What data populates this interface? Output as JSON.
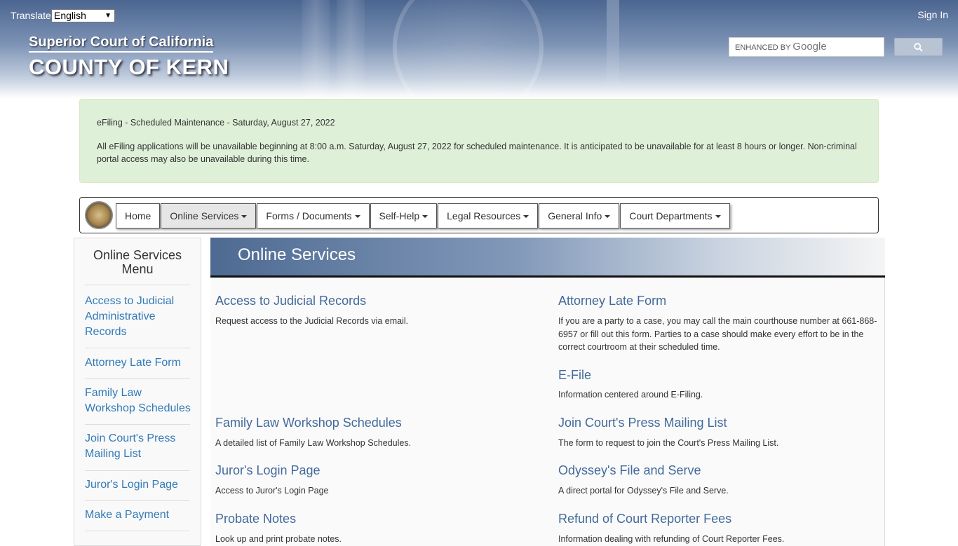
{
  "header": {
    "translate_label": "Translate",
    "language": "English",
    "sign_in": "Sign In",
    "court_name": "Superior Court of California",
    "county_name": "COUNTY OF KERN",
    "search_enhanced": "ENHANCED BY",
    "search_brand": "Google"
  },
  "alert": {
    "title": "eFiling - Scheduled Maintenance - Saturday, August 27, 2022",
    "body": "All eFiling applications will be unavailable beginning at 8:00 a.m. Saturday, August 27, 2022 for scheduled maintenance.  It is anticipated to be unavailable for at least 8 hours or longer.  Non-criminal portal access may also be unavailable during this time."
  },
  "nav": {
    "items": [
      {
        "label": "Home"
      },
      {
        "label": "Online Services"
      },
      {
        "label": "Forms / Documents"
      },
      {
        "label": "Self-Help"
      },
      {
        "label": "Legal Resources"
      },
      {
        "label": "General Info"
      },
      {
        "label": "Court Departments"
      }
    ]
  },
  "sidebar": {
    "title": "Online Services Menu",
    "links": [
      {
        "label": "Access to Judicial Administrative Records"
      },
      {
        "label": "Attorney Late Form"
      },
      {
        "label": "Family Law Workshop Schedules"
      },
      {
        "label": "Join Court's Press Mailing List"
      },
      {
        "label": "Juror's Login Page"
      },
      {
        "label": "Make a Payment"
      }
    ]
  },
  "main": {
    "title": "Online Services",
    "items": [
      {
        "title": "Access to Judicial Records",
        "desc": "Request access to the Judicial Records via email."
      },
      {
        "title": "Attorney Late Form",
        "desc": "If you are a party to a case, you may call the main courthouse number at 661-868-6957 or fill out this form. Parties to a case should make every effort to be in the correct courtroom at their scheduled time."
      },
      {
        "title": "E-File",
        "desc": "Information centered around E-Filing."
      },
      {
        "title": "Family Law Workshop Schedules",
        "desc": "A detailed list of Family Law Workshop Schedules."
      },
      {
        "title": "Join Court's Press Mailing List",
        "desc": "The form to request to join the Court's Press Mailing List."
      },
      {
        "title": "Juror's Login Page",
        "desc": "Access to Juror's Login Page"
      },
      {
        "title": "Odyssey's File and Serve",
        "desc": "A direct portal for Odyssey's File and Serve."
      },
      {
        "title": "Probate Notes",
        "desc": "Look up and print probate notes."
      },
      {
        "title": "Refund of Court Reporter Fees",
        "desc": "Information dealing with refunding of Court Reporter Fees."
      }
    ]
  }
}
